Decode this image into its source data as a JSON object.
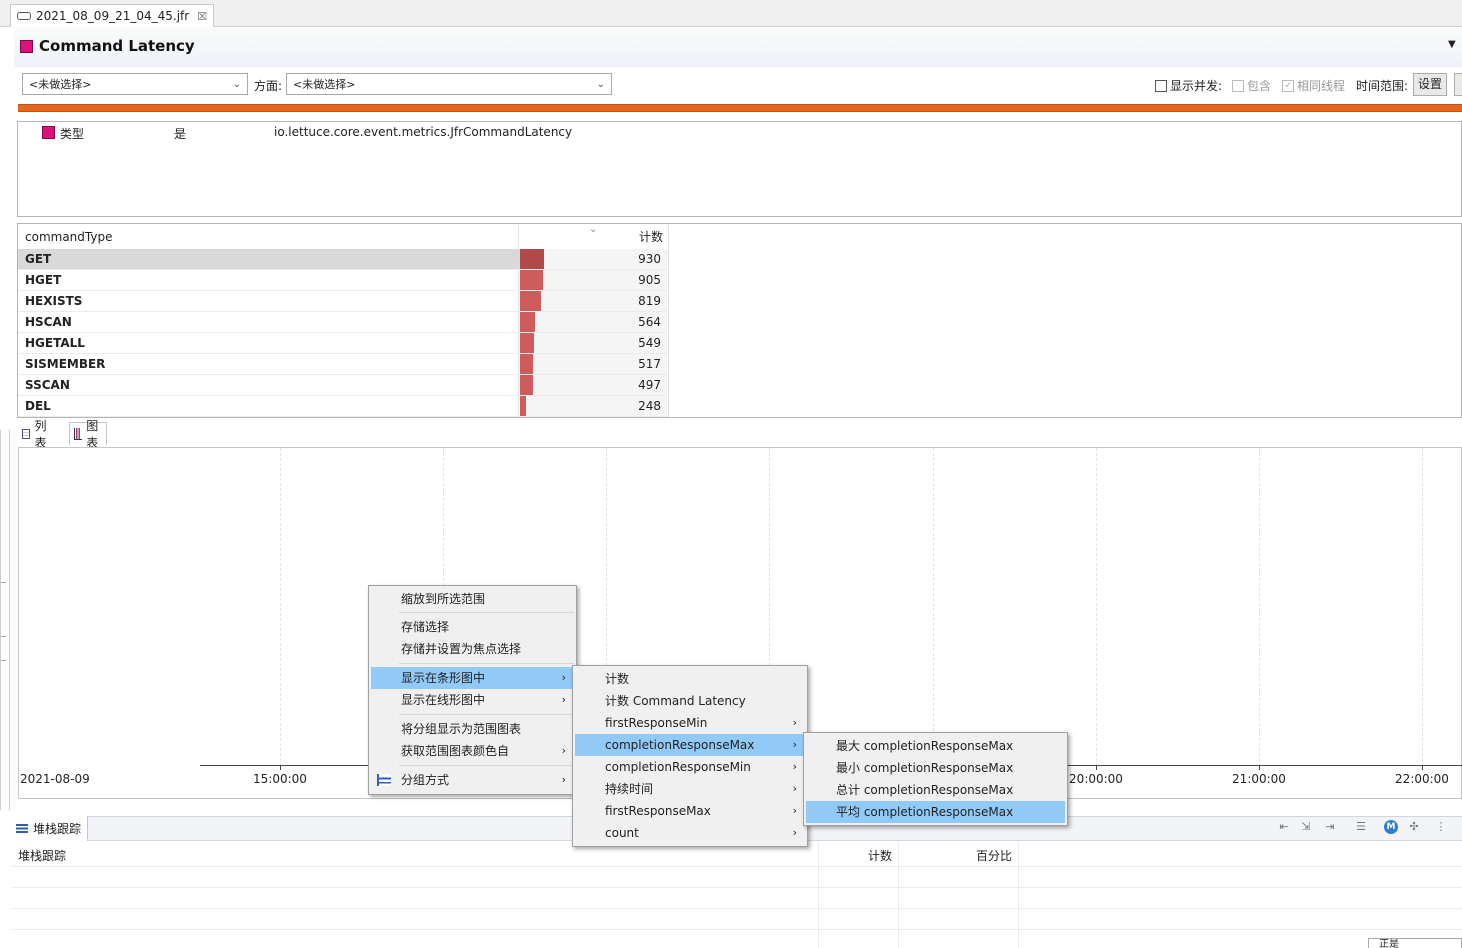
{
  "editor_tab": {
    "title": "2021_08_09_21_04_45.jfr",
    "close": "☒"
  },
  "page": {
    "title": "Command Latency",
    "menu_arrow": "▼"
  },
  "filters": {
    "select1": "<未做选择>",
    "aspect_label": "方面:",
    "select2": "<未做选择>",
    "show_concurrent": "显示并发:",
    "contains": "包含",
    "same_thread": "相同线程",
    "time_range": "时间范围:",
    "settings_button": "设置",
    "same_thread_checked": "✓"
  },
  "filter_row": {
    "attribute": "类型",
    "operator": "是",
    "value": "io.lettuce.core.event.metrics.JfrCommandLatency"
  },
  "table": {
    "col_name": "commandType",
    "col_sort": "⌄",
    "col_count": "计数",
    "max": 930,
    "rows": [
      {
        "name": "GET",
        "count": "930",
        "value": 930
      },
      {
        "name": "HGET",
        "count": "905",
        "value": 905
      },
      {
        "name": "HEXISTS",
        "count": "819",
        "value": 819
      },
      {
        "name": "HSCAN",
        "count": "564",
        "value": 564
      },
      {
        "name": "HGETALL",
        "count": "549",
        "value": 549
      },
      {
        "name": "SISMEMBER",
        "count": "517",
        "value": 517
      },
      {
        "name": "SSCAN",
        "count": "497",
        "value": 497
      },
      {
        "name": "DEL",
        "count": "248",
        "value": 248
      }
    ]
  },
  "view_tabs": {
    "list": "列表",
    "chart": "图表"
  },
  "chart": {
    "date": "2021-08-09",
    "ticks": [
      "15:00:00",
      "20:00:00",
      "21:00:00",
      "22:00:00"
    ]
  },
  "stack": {
    "tab": "堆栈跟踪",
    "col_trace": "堆栈跟踪",
    "col_count": "计数",
    "col_percent": "百分比",
    "tooltip_stub": "正是"
  },
  "context_menu": {
    "zoom": "缩放到所选范围",
    "store": "存储选择",
    "store_focus": "存储并设置为焦点选择",
    "show_bar": "显示在条形图中",
    "show_line": "显示在线形图中",
    "group_range": "将分组显示为范围图表",
    "get_color": "获取范围图表颜色自",
    "group_by": "分组方式",
    "arrow": "›"
  },
  "submenu": {
    "count": "计数",
    "count_latency": "计数 Command Latency",
    "first_min": "firstResponseMin",
    "completion_max": "completionResponseMax",
    "completion_min": "completionResponseMin",
    "duration": "持续时间",
    "first_max": "firstResponseMax",
    "count_raw": "count"
  },
  "submenu2": {
    "max": "最大 completionResponseMax",
    "min": "最小 completionResponseMax",
    "total": "总计 completionResponseMax",
    "avg": "平均 completionResponseMax"
  },
  "colors": {
    "accent": "#e0107a",
    "bar": "#cd5c5c",
    "highlight": "#91c9f7",
    "orange": "#e9661f"
  }
}
